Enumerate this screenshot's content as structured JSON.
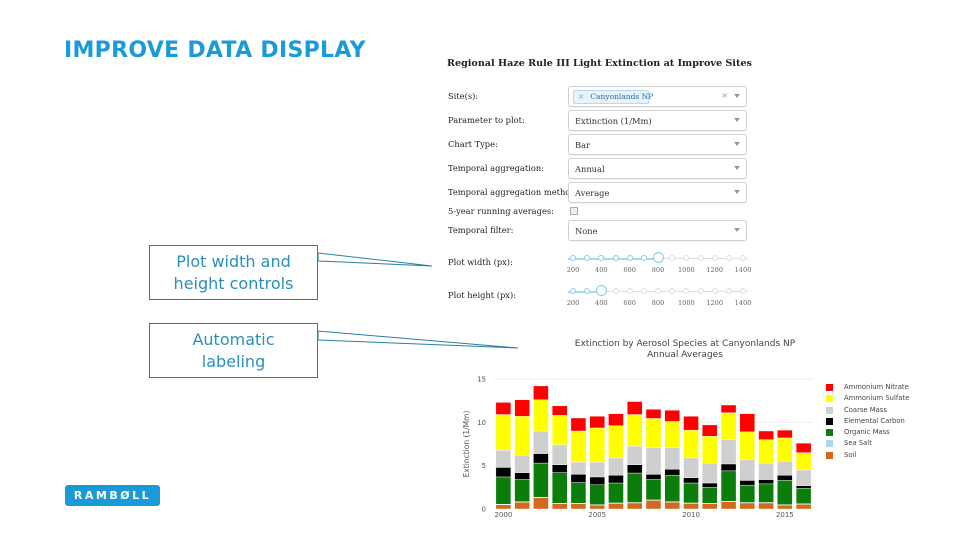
{
  "slide": {
    "title": "IMPROVE DATA DISPLAY",
    "callouts": [
      {
        "line1": "Plot width and",
        "line2": "height controls"
      },
      {
        "line1": "Automatic",
        "line2": "labeling"
      }
    ],
    "logo": "RAMBØLL",
    "brand_color": "#1a9ad6"
  },
  "panel": {
    "title": "Regional Haze Rule III Light Extinction at Improve Sites",
    "fields": [
      {
        "label": "Site(s):",
        "type": "multiselect",
        "chip": "Canyonlands NP",
        "clear": "×"
      },
      {
        "label": "Parameter to plot:",
        "type": "select",
        "value": "Extinction (1/Mm)"
      },
      {
        "label": "Chart Type:",
        "type": "select",
        "value": "Bar"
      },
      {
        "label": "Temporal aggregation:",
        "type": "select",
        "value": "Annual"
      },
      {
        "label": "Temporal aggregation method:",
        "type": "select",
        "value": "Average"
      },
      {
        "label": "5-year running averages:",
        "type": "checkbox",
        "checked": false
      },
      {
        "label": "Temporal filter:",
        "type": "select",
        "value": "None"
      }
    ],
    "sliders": [
      {
        "label": "Plot width (px):",
        "min": 200,
        "max": 1400,
        "step": 100,
        "value": 800,
        "tick_labels": [
          "200",
          "400",
          "600",
          "800",
          "1000",
          "1200",
          "1400"
        ]
      },
      {
        "label": "Plot height (px):",
        "min": 200,
        "max": 1400,
        "step": 100,
        "value": 400,
        "tick_labels": [
          "200",
          "400",
          "600",
          "800",
          "1000",
          "1200",
          "1400"
        ]
      }
    ]
  },
  "chart_data": {
    "type": "bar",
    "stacked": true,
    "title": "Extinction by Aerosol Species at Canyonlands NP",
    "subtitle": "Annual Averages",
    "xlabel": "",
    "ylabel": "Extinction (1/Mm)",
    "ylim": [
      0,
      15
    ],
    "yticks": [
      0,
      5,
      10,
      15
    ],
    "xtick_labels": [
      {
        "at": 2000,
        "label": "2000"
      },
      {
        "at": 2005,
        "label": "2005"
      },
      {
        "at": 2010,
        "label": "2010"
      },
      {
        "at": 2015,
        "label": "2015"
      }
    ],
    "grid": true,
    "legend_position": "right",
    "categories": [
      2000,
      2001,
      2002,
      2003,
      2004,
      2005,
      2006,
      2007,
      2008,
      2009,
      2010,
      2011,
      2012,
      2013,
      2014,
      2015,
      2016
    ],
    "series": [
      {
        "name": "Soil",
        "color": "#d2691e",
        "values": [
          0.5,
          0.8,
          1.3,
          0.6,
          0.6,
          0.45,
          0.65,
          0.7,
          1.0,
          0.8,
          0.65,
          0.6,
          0.85,
          0.7,
          0.7,
          0.45,
          0.55
        ]
      },
      {
        "name": "Sea Salt",
        "color": "#add8e6",
        "values": [
          0.05,
          0.05,
          0.05,
          0.05,
          0.05,
          0.05,
          0.05,
          0.05,
          0.05,
          0.05,
          0.05,
          0.05,
          0.05,
          0.05,
          0.05,
          0.05,
          0.05
        ]
      },
      {
        "name": "Organic Mass",
        "color": "#0a7d0a",
        "values": [
          3.15,
          2.55,
          3.95,
          3.55,
          2.4,
          2.3,
          2.3,
          3.4,
          2.35,
          3.05,
          2.3,
          1.85,
          3.5,
          2.0,
          2.15,
          2.8,
          1.8
        ]
      },
      {
        "name": "Elemental Carbon",
        "color": "#000000",
        "values": [
          1.1,
          0.8,
          1.1,
          0.9,
          0.95,
          0.9,
          0.9,
          0.95,
          0.6,
          0.7,
          0.6,
          0.5,
          0.8,
          0.55,
          0.5,
          0.6,
          0.3
        ]
      },
      {
        "name": "Coarse Mass",
        "color": "#cfcfcf",
        "values": [
          2.0,
          2.0,
          2.6,
          2.3,
          1.4,
          1.7,
          2.0,
          2.15,
          3.1,
          2.5,
          2.3,
          2.3,
          2.8,
          2.4,
          1.9,
          1.6,
          1.8
        ]
      },
      {
        "name": "Ammonium Sulfate",
        "color": "#ffff00",
        "values": [
          4.1,
          4.5,
          3.6,
          3.4,
          3.6,
          3.95,
          3.7,
          3.65,
          3.35,
          3.0,
          3.2,
          3.1,
          3.1,
          3.2,
          2.7,
          2.7,
          2.0
        ]
      },
      {
        "name": "Ammonium Nitrate",
        "color": "#ff0000",
        "values": [
          1.4,
          1.9,
          1.6,
          1.1,
          1.5,
          1.35,
          1.4,
          1.5,
          1.05,
          1.3,
          1.6,
          1.3,
          0.9,
          2.1,
          1.0,
          0.9,
          1.1
        ]
      }
    ],
    "legend_order": [
      "Ammonium Nitrate",
      "Ammonium Sulfate",
      "Coarse Mass",
      "Elemental Carbon",
      "Organic Mass",
      "Sea Salt",
      "Soil"
    ]
  }
}
